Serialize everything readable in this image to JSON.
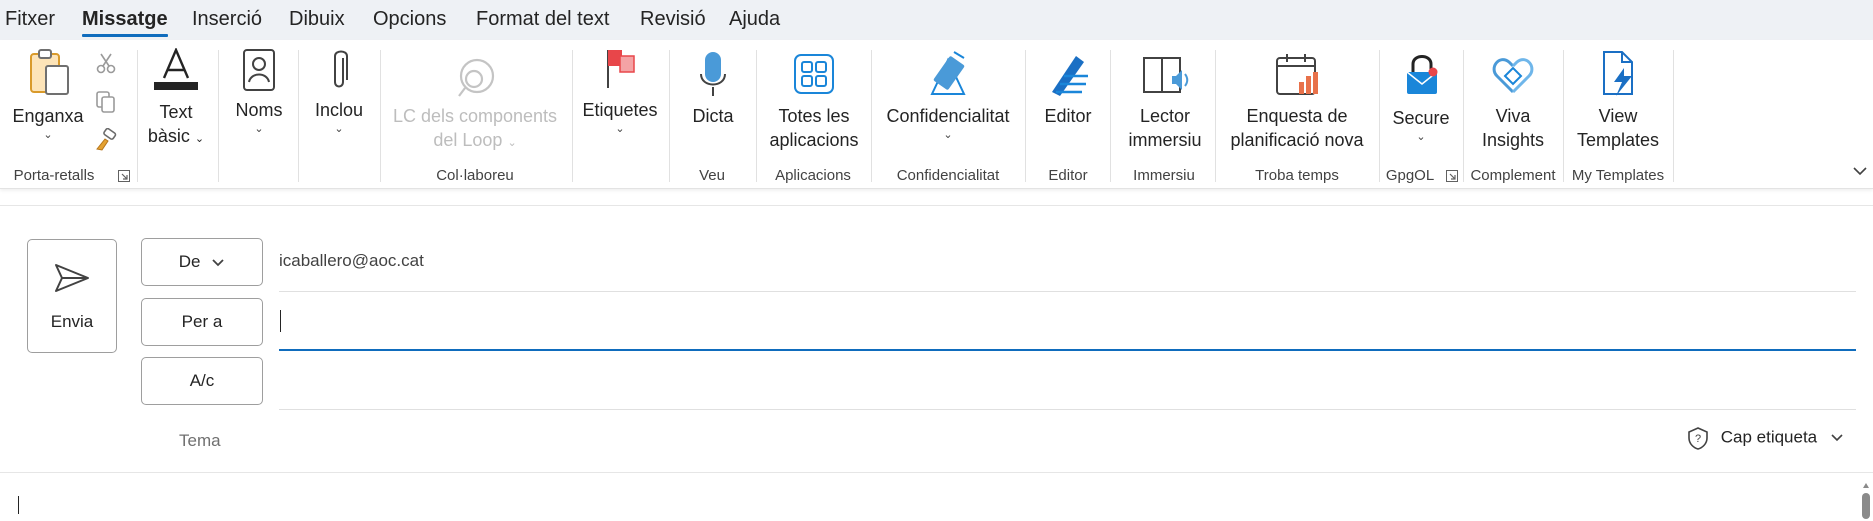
{
  "menu": {
    "tabs": [
      "Fitxer",
      "Missatge",
      "Inserció",
      "Dibuix",
      "Opcions",
      "Format del text",
      "Revisió",
      "Ajuda"
    ],
    "active": "Missatge"
  },
  "ribbon": {
    "paste": "Enganxa",
    "text_basic_1": "Text",
    "text_basic_2": "bàsic",
    "names": "Noms",
    "include": "Inclou",
    "loop_1": "LC dels components",
    "loop_2": "del Loop",
    "tags": "Etiquetes",
    "dictate": "Dicta",
    "allapps_1": "Totes les",
    "allapps_2": "aplicacions",
    "confidentiality": "Confidencialitat",
    "editor": "Editor",
    "reader_1": "Lector",
    "reader_2": "immersiu",
    "poll_1": "Enquesta de",
    "poll_2": "planificació nova",
    "secure": "Secure",
    "viva_1": "Viva",
    "viva_2": "Insights",
    "templates_1": "View",
    "templates_2": "Templates",
    "groups": {
      "clipboard": "Porta-retalls",
      "collab": "Col·laboreu",
      "voice": "Veu",
      "apps": "Aplicacions",
      "confidentiality": "Confidencialitat",
      "editor": "Editor",
      "immersive": "Immersiu",
      "findtime": "Troba temps",
      "gpgol": "GpgOL",
      "addin": "Complement",
      "mytemplates": "My Templates"
    }
  },
  "compose": {
    "send": "Envia",
    "from_label": "De",
    "from_value": "icaballero@aoc.cat",
    "to_label": "Per a",
    "to_value": "",
    "cc_label": "A/c",
    "cc_value": "",
    "subject_label": "Tema",
    "sensitivity": "Cap etiqueta"
  },
  "colors": {
    "accent": "#0f6cbd",
    "menubar_bg": "#eef1f5",
    "flag_red": "#e8464a"
  }
}
